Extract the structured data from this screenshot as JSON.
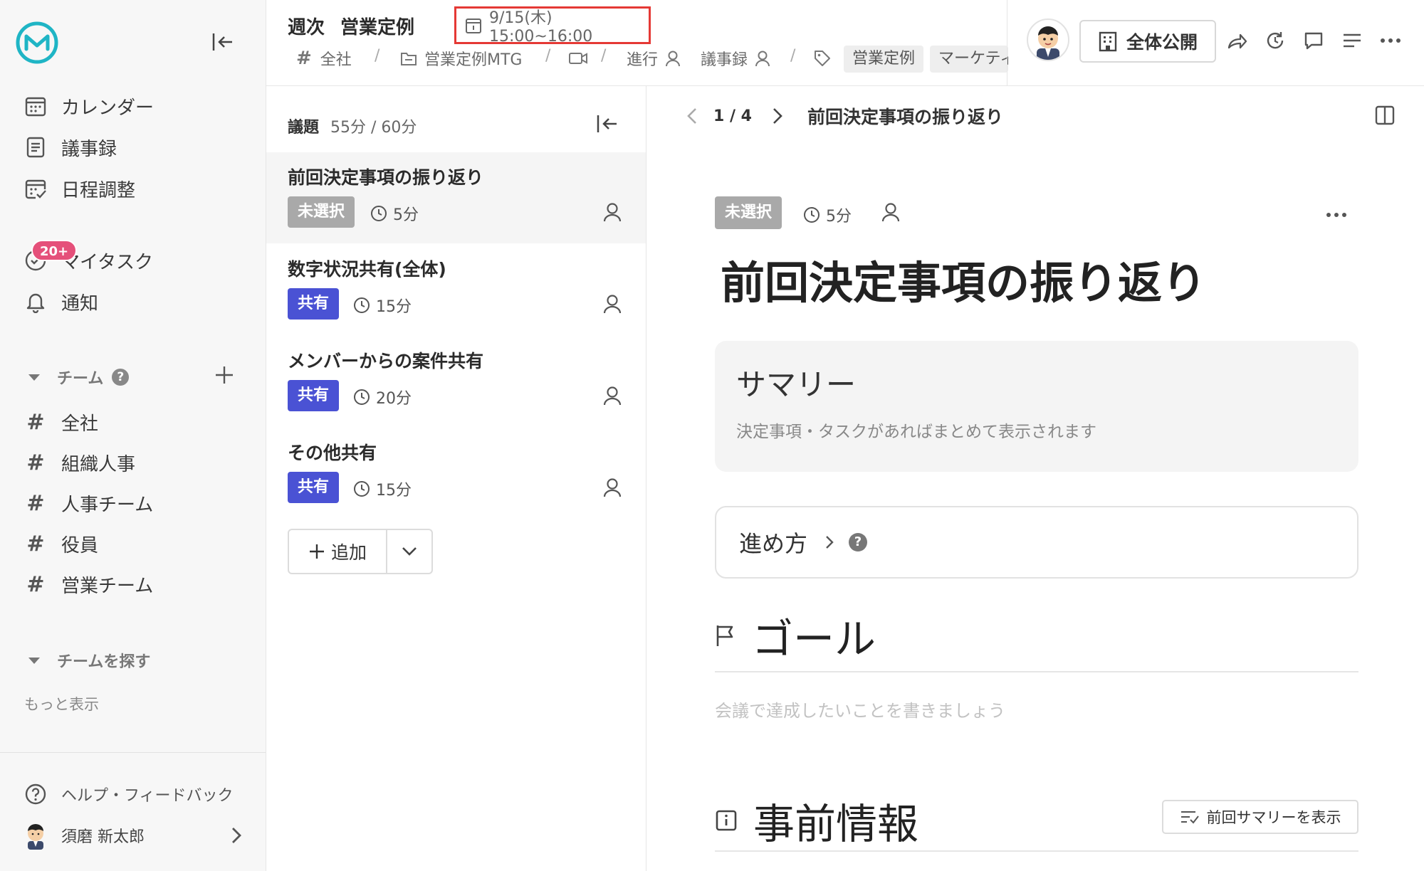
{
  "sidebar": {
    "nav": [
      {
        "label": "カレンダー",
        "icon": "calendar-icon"
      },
      {
        "label": "議事録",
        "icon": "document-icon"
      },
      {
        "label": "日程調整",
        "icon": "schedule-icon"
      },
      {
        "label": "マイタスク",
        "icon": "task-icon"
      },
      {
        "label": "通知",
        "icon": "bell-icon"
      }
    ],
    "task_badge": "20+",
    "team_section": {
      "label": "チーム"
    },
    "teams": [
      "全社",
      "組織人事",
      "人事チーム",
      "役員",
      "営業チーム"
    ],
    "explore_section": {
      "label": "チームを探す"
    },
    "more": "もっと表示",
    "help": "ヘルプ・フィードバック",
    "user": {
      "name": "須磨 新太郎"
    }
  },
  "header": {
    "title_prefix": "週次",
    "title": "営業定例",
    "datetime": "9/15(木) 15:00~16:00",
    "breadcrumbs": {
      "team": "全社",
      "folder": "営業定例MTG",
      "facilitator": "進行",
      "minutes": "議事録"
    },
    "tags": [
      "営業定例",
      "マーケティ"
    ],
    "visibility": "全体公開"
  },
  "agenda": {
    "label": "議題",
    "time_summary": "55分 / 60分",
    "items": [
      {
        "title": "前回決定事項の振り返り",
        "status": "未選択",
        "duration": "5分"
      },
      {
        "title": "数字状況共有(全体)",
        "status": "共有",
        "duration": "15分"
      },
      {
        "title": "メンバーからの案件共有",
        "status": "共有",
        "duration": "20分"
      },
      {
        "title": "その他共有",
        "status": "共有",
        "duration": "15分"
      }
    ],
    "add_label": "追加"
  },
  "main": {
    "pager": "1 / 4",
    "pager_title": "前回決定事項の振り返り",
    "status": "未選択",
    "duration": "5分",
    "heading": "前回決定事項の振り返り",
    "summary": {
      "title": "サマリー",
      "description": "決定事項・タスクがあればまとめて表示されます"
    },
    "howto": "進め方",
    "goal": {
      "title": "ゴール",
      "placeholder": "会議で達成したいことを書きましょう"
    },
    "preinfo": {
      "title": "事前情報",
      "button": "前回サマリーを表示"
    }
  },
  "colors": {
    "accent_blue": "#4a52d4",
    "badge_gray": "#a9a9a9",
    "task_badge": "#e5507a",
    "logo": "#1fb5c5",
    "highlight_box": "#e53935"
  }
}
